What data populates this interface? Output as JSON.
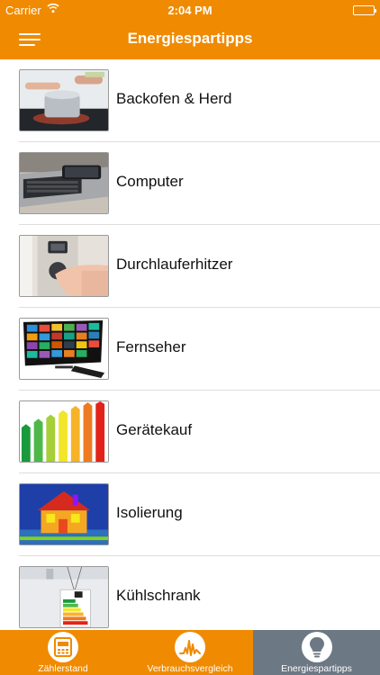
{
  "status_bar": {
    "carrier": "Carrier",
    "time": "2:04 PM"
  },
  "nav": {
    "title": "Energiespartipps",
    "menu_icon": "hamburger-menu-icon"
  },
  "list": {
    "items": [
      {
        "label": "Backofen & Herd",
        "thumb": "cooking-pot-stove-photo"
      },
      {
        "label": "Computer",
        "thumb": "laptop-smartphone-photo"
      },
      {
        "label": "Durchlauferhitzer",
        "thumb": "water-heater-control-photo"
      },
      {
        "label": "Fernseher",
        "thumb": "tv-remote-photo"
      },
      {
        "label": "Gerätekauf",
        "thumb": "energy-label-bars-image"
      },
      {
        "label": "Isolierung",
        "thumb": "thermal-house-image"
      },
      {
        "label": "Kühlschrank",
        "thumb": "fridge-energy-label-photo"
      }
    ]
  },
  "tabbar": {
    "tabs": [
      {
        "label": "Zählerstand",
        "icon": "meter-icon",
        "selected": false
      },
      {
        "label": "Verbrauchsvergleich",
        "icon": "chart-wave-icon",
        "selected": false
      },
      {
        "label": "Energiespartipps",
        "icon": "lightbulb-icon",
        "selected": true
      }
    ]
  },
  "colors": {
    "brand": "#f08a00",
    "selected_tab": "#6d7885",
    "separator": "#dedede"
  }
}
